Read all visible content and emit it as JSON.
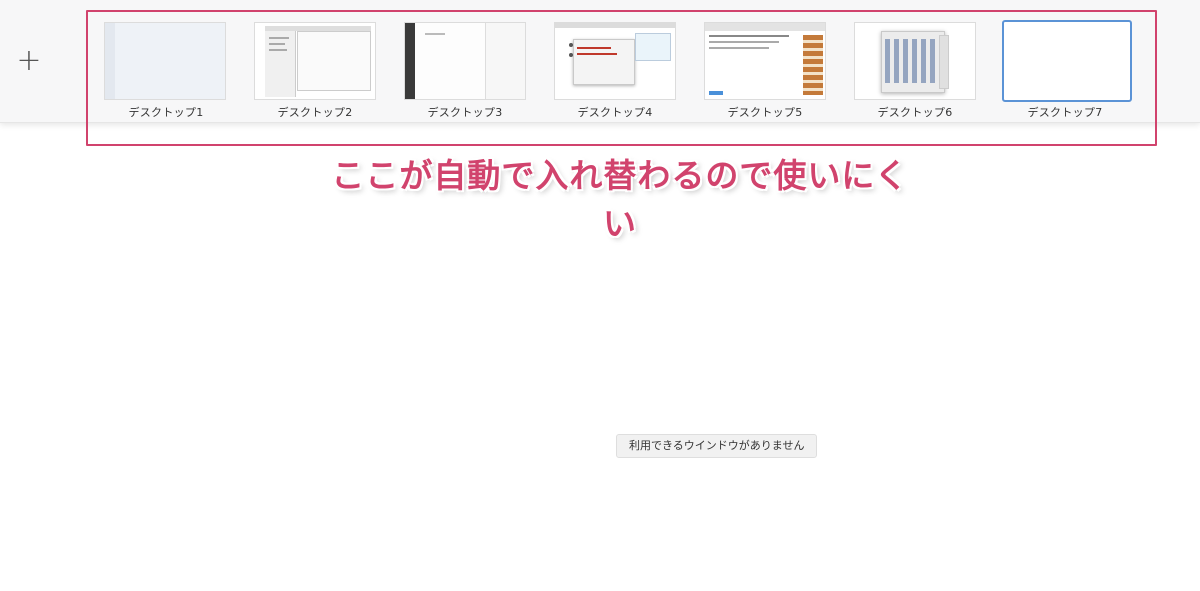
{
  "mission_control": {
    "add_button_symbol": "+",
    "desktops": [
      {
        "label": "デスクトップ1",
        "current": false
      },
      {
        "label": "デスクトップ2",
        "current": false
      },
      {
        "label": "デスクトップ3",
        "current": false
      },
      {
        "label": "デスクトップ4",
        "current": false
      },
      {
        "label": "デスクトップ5",
        "current": false
      },
      {
        "label": "デスクトップ6",
        "current": false
      },
      {
        "label": "デスクトップ7",
        "current": true
      }
    ],
    "empty_message": "利用できるウインドウがありません"
  },
  "annotation": {
    "text": "ここが自動で入れ替わるので使いにくい",
    "color": "#d1436d"
  },
  "colors": {
    "highlight": "#d1436d",
    "current_desktop_border": "#5b93d6"
  }
}
